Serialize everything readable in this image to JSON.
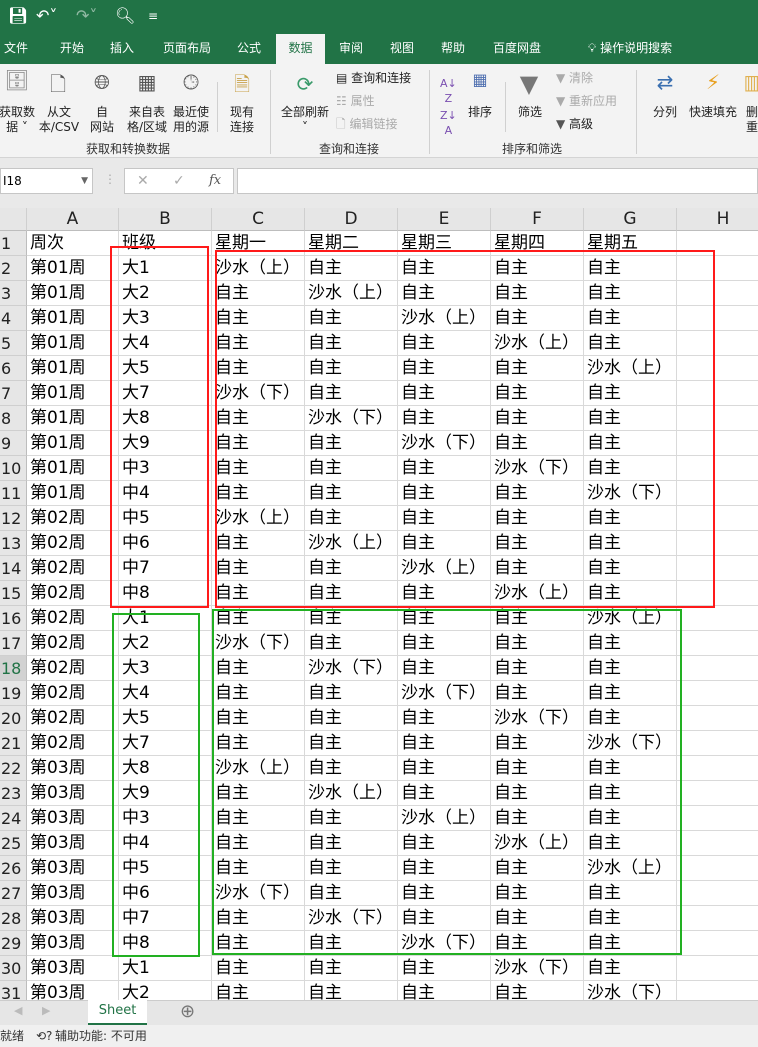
{
  "qat": {
    "save": "save-icon",
    "undo": "undo-icon",
    "redo": "redo-icon",
    "preview": "print-preview-icon"
  },
  "tabs": [
    "文件",
    "开始",
    "插入",
    "页面布局",
    "公式",
    "数据",
    "审阅",
    "视图",
    "帮助",
    "百度网盘",
    "操作说明搜索"
  ],
  "active_tab": "数据",
  "ribbon": {
    "get_data": "获取数\n据 ˅",
    "from_csv": "从文\n本/CSV",
    "from_web": "自\n网站",
    "from_table": "来自表\n格/区域",
    "recent": "最近使\n用的源",
    "existing": "现有\n连接",
    "group1": "获取和转换数据",
    "refresh_all": "全部刷新\n˅",
    "queries": "查询和连接",
    "properties": "属性",
    "edit_links": "编辑链接",
    "group2": "查询和连接",
    "sort": "排序",
    "filter": "筛选",
    "clear": "清除",
    "reapply": "重新应用",
    "advanced": "高级",
    "group3": "排序和筛选",
    "text_to_columns": "分列",
    "flash_fill": "快速填充",
    "remove_dup": "删\n重"
  },
  "name_box": "I18",
  "formula": "",
  "columns": [
    "A",
    "B",
    "C",
    "D",
    "E",
    "F",
    "G",
    "H"
  ],
  "rows": [
    [
      "周次",
      "班级",
      "星期一",
      "星期二",
      "星期三",
      "星期四",
      "星期五"
    ],
    [
      "第01周",
      "大1",
      "沙水（上）",
      "自主",
      "自主",
      "自主",
      "自主"
    ],
    [
      "第01周",
      "大2",
      "自主",
      "沙水（上）",
      "自主",
      "自主",
      "自主"
    ],
    [
      "第01周",
      "大3",
      "自主",
      "自主",
      "沙水（上）",
      "自主",
      "自主"
    ],
    [
      "第01周",
      "大4",
      "自主",
      "自主",
      "自主",
      "沙水（上）",
      "自主"
    ],
    [
      "第01周",
      "大5",
      "自主",
      "自主",
      "自主",
      "自主",
      "沙水（上）"
    ],
    [
      "第01周",
      "大7",
      "沙水（下）",
      "自主",
      "自主",
      "自主",
      "自主"
    ],
    [
      "第01周",
      "大8",
      "自主",
      "沙水（下）",
      "自主",
      "自主",
      "自主"
    ],
    [
      "第01周",
      "大9",
      "自主",
      "自主",
      "沙水（下）",
      "自主",
      "自主"
    ],
    [
      "第01周",
      "中3",
      "自主",
      "自主",
      "自主",
      "沙水（下）",
      "自主"
    ],
    [
      "第01周",
      "中4",
      "自主",
      "自主",
      "自主",
      "自主",
      "沙水（下）"
    ],
    [
      "第02周",
      "中5",
      "沙水（上）",
      "自主",
      "自主",
      "自主",
      "自主"
    ],
    [
      "第02周",
      "中6",
      "自主",
      "沙水（上）",
      "自主",
      "自主",
      "自主"
    ],
    [
      "第02周",
      "中7",
      "自主",
      "自主",
      "沙水（上）",
      "自主",
      "自主"
    ],
    [
      "第02周",
      "中8",
      "自主",
      "自主",
      "自主",
      "沙水（上）",
      "自主"
    ],
    [
      "第02周",
      "大1",
      "自主",
      "自主",
      "自主",
      "自主",
      "沙水（上）"
    ],
    [
      "第02周",
      "大2",
      "沙水（下）",
      "自主",
      "自主",
      "自主",
      "自主"
    ],
    [
      "第02周",
      "大3",
      "自主",
      "沙水（下）",
      "自主",
      "自主",
      "自主"
    ],
    [
      "第02周",
      "大4",
      "自主",
      "自主",
      "沙水（下）",
      "自主",
      "自主"
    ],
    [
      "第02周",
      "大5",
      "自主",
      "自主",
      "自主",
      "沙水（下）",
      "自主"
    ],
    [
      "第02周",
      "大7",
      "自主",
      "自主",
      "自主",
      "自主",
      "沙水（下）"
    ],
    [
      "第03周",
      "大8",
      "沙水（上）",
      "自主",
      "自主",
      "自主",
      "自主"
    ],
    [
      "第03周",
      "大9",
      "自主",
      "沙水（上）",
      "自主",
      "自主",
      "自主"
    ],
    [
      "第03周",
      "中3",
      "自主",
      "自主",
      "沙水（上）",
      "自主",
      "自主"
    ],
    [
      "第03周",
      "中4",
      "自主",
      "自主",
      "自主",
      "沙水（上）",
      "自主"
    ],
    [
      "第03周",
      "中5",
      "自主",
      "自主",
      "自主",
      "自主",
      "沙水（上）"
    ],
    [
      "第03周",
      "中6",
      "沙水（下）",
      "自主",
      "自主",
      "自主",
      "自主"
    ],
    [
      "第03周",
      "中7",
      "自主",
      "沙水（下）",
      "自主",
      "自主",
      "自主"
    ],
    [
      "第03周",
      "中8",
      "自主",
      "自主",
      "沙水（下）",
      "自主",
      "自主"
    ],
    [
      "第03周",
      "大1",
      "自主",
      "自主",
      "自主",
      "沙水（下）",
      "自主"
    ],
    [
      "第03周",
      "大2",
      "自主",
      "自主",
      "自主",
      "自主",
      "沙水（下）"
    ]
  ],
  "selected_row": 18,
  "highlight_colors": {
    "red": "#ff1a1a",
    "green": "#22b022"
  },
  "sheet_tab": "Sheet",
  "add_sheet": "⊕",
  "status": {
    "ready": "就绪",
    "accessibility": "辅助功能: 不可用"
  }
}
